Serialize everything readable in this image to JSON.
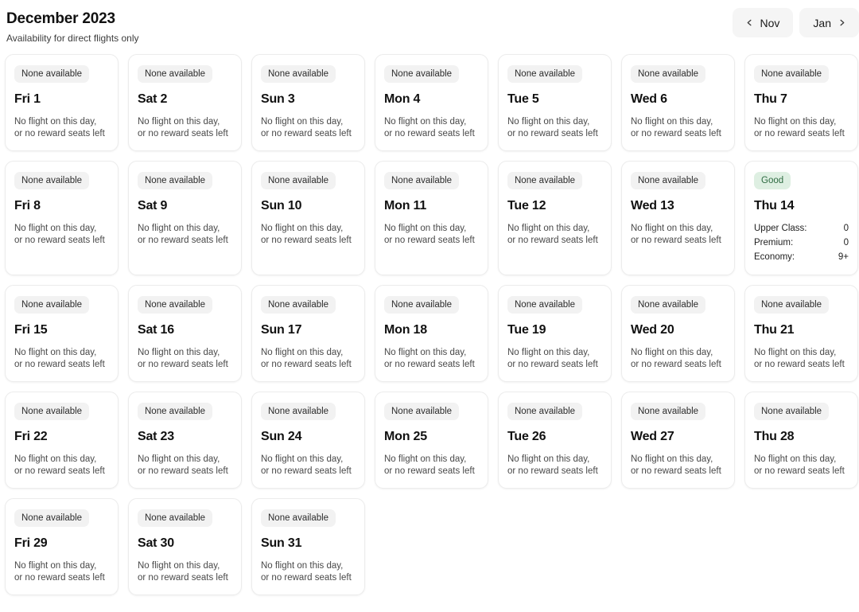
{
  "header": {
    "title": "December 2023",
    "subtitle": "Availability for direct flights only",
    "prev_label": "Nov",
    "next_label": "Jan",
    "prev_icon": "chevron-left-icon",
    "next_icon": "chevron-right-icon"
  },
  "labels": {
    "none_available": "None available",
    "good": "Good",
    "no_flight_note": "No flight on this day,\nor no reward seats left"
  },
  "colors": {
    "badge_neutral_bg": "#f2f2f2",
    "badge_neutral_text": "#2c2c2c",
    "badge_good_bg": "#deefe2",
    "badge_good_text": "#2e6b42",
    "card_border": "#ececec",
    "nav_button_bg": "#f5f5f5"
  },
  "days": [
    {
      "day": "Fri 1",
      "status": "None available",
      "status_type": "none",
      "note": "No flight on this day,\nor no reward seats left"
    },
    {
      "day": "Sat 2",
      "status": "None available",
      "status_type": "none",
      "note": "No flight on this day,\nor no reward seats left"
    },
    {
      "day": "Sun 3",
      "status": "None available",
      "status_type": "none",
      "note": "No flight on this day,\nor no reward seats left"
    },
    {
      "day": "Mon 4",
      "status": "None available",
      "status_type": "none",
      "note": "No flight on this day,\nor no reward seats left"
    },
    {
      "day": "Tue 5",
      "status": "None available",
      "status_type": "none",
      "note": "No flight on this day,\nor no reward seats left"
    },
    {
      "day": "Wed 6",
      "status": "None available",
      "status_type": "none",
      "note": "No flight on this day,\nor no reward seats left"
    },
    {
      "day": "Thu 7",
      "status": "None available",
      "status_type": "none",
      "note": "No flight on this day,\nor no reward seats left"
    },
    {
      "day": "Fri 8",
      "status": "None available",
      "status_type": "none",
      "note": "No flight on this day,\nor no reward seats left"
    },
    {
      "day": "Sat 9",
      "status": "None available",
      "status_type": "none",
      "note": "No flight on this day,\nor no reward seats left"
    },
    {
      "day": "Sun 10",
      "status": "None available",
      "status_type": "none",
      "note": "No flight on this day,\nor no reward seats left"
    },
    {
      "day": "Mon 11",
      "status": "None available",
      "status_type": "none",
      "note": "No flight on this day,\nor no reward seats left"
    },
    {
      "day": "Tue 12",
      "status": "None available",
      "status_type": "none",
      "note": "No flight on this day,\nor no reward seats left"
    },
    {
      "day": "Wed 13",
      "status": "None available",
      "status_type": "none",
      "note": "No flight on this day,\nor no reward seats left"
    },
    {
      "day": "Thu 14",
      "status": "Good",
      "status_type": "good",
      "cabins": [
        {
          "label": "Upper Class:",
          "value": "0"
        },
        {
          "label": "Premium:",
          "value": "0"
        },
        {
          "label": "Economy:",
          "value": "9+"
        }
      ]
    },
    {
      "day": "Fri 15",
      "status": "None available",
      "status_type": "none",
      "note": "No flight on this day,\nor no reward seats left"
    },
    {
      "day": "Sat 16",
      "status": "None available",
      "status_type": "none",
      "note": "No flight on this day,\nor no reward seats left"
    },
    {
      "day": "Sun 17",
      "status": "None available",
      "status_type": "none",
      "note": "No flight on this day,\nor no reward seats left"
    },
    {
      "day": "Mon 18",
      "status": "None available",
      "status_type": "none",
      "note": "No flight on this day,\nor no reward seats left"
    },
    {
      "day": "Tue 19",
      "status": "None available",
      "status_type": "none",
      "note": "No flight on this day,\nor no reward seats left"
    },
    {
      "day": "Wed 20",
      "status": "None available",
      "status_type": "none",
      "note": "No flight on this day,\nor no reward seats left"
    },
    {
      "day": "Thu 21",
      "status": "None available",
      "status_type": "none",
      "note": "No flight on this day,\nor no reward seats left"
    },
    {
      "day": "Fri 22",
      "status": "None available",
      "status_type": "none",
      "note": "No flight on this day,\nor no reward seats left"
    },
    {
      "day": "Sat 23",
      "status": "None available",
      "status_type": "none",
      "note": "No flight on this day,\nor no reward seats left"
    },
    {
      "day": "Sun 24",
      "status": "None available",
      "status_type": "none",
      "note": "No flight on this day,\nor no reward seats left"
    },
    {
      "day": "Mon 25",
      "status": "None available",
      "status_type": "none",
      "note": "No flight on this day,\nor no reward seats left"
    },
    {
      "day": "Tue 26",
      "status": "None available",
      "status_type": "none",
      "note": "No flight on this day,\nor no reward seats left"
    },
    {
      "day": "Wed 27",
      "status": "None available",
      "status_type": "none",
      "note": "No flight on this day,\nor no reward seats left"
    },
    {
      "day": "Thu 28",
      "status": "None available",
      "status_type": "none",
      "note": "No flight on this day,\nor no reward seats left"
    },
    {
      "day": "Fri 29",
      "status": "None available",
      "status_type": "none",
      "note": "No flight on this day,\nor no reward seats left"
    },
    {
      "day": "Sat 30",
      "status": "None available",
      "status_type": "none",
      "note": "No flight on this day,\nor no reward seats left"
    },
    {
      "day": "Sun 31",
      "status": "None available",
      "status_type": "none",
      "note": "No flight on this day,\nor no reward seats left"
    }
  ]
}
